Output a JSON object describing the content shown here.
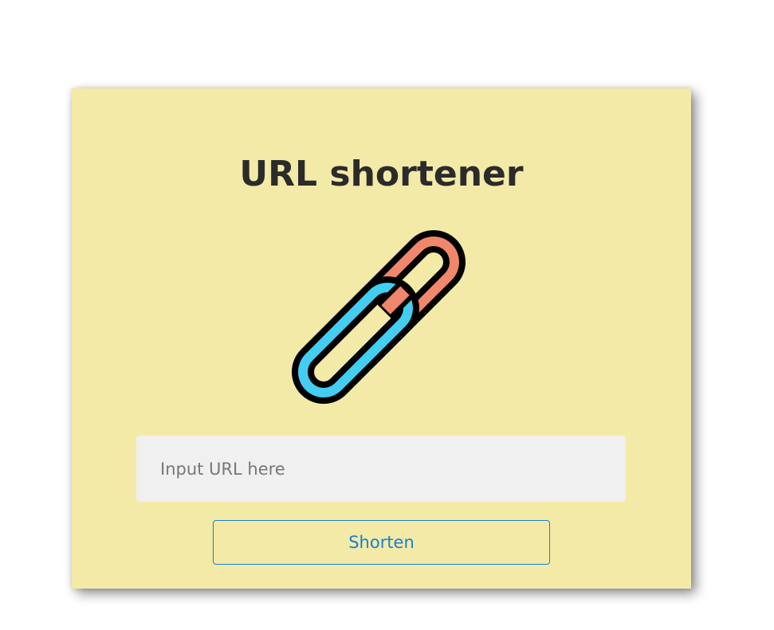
{
  "app": {
    "title": "URL shortener"
  },
  "logo": {
    "icon": "chain-link-icon",
    "colors": {
      "front_link": "#43cdf0",
      "back_link": "#f0866b",
      "outline": "#000000"
    }
  },
  "form": {
    "url_input": {
      "value": "",
      "placeholder": "Input URL here"
    },
    "shorten_label": "Shorten"
  },
  "colors": {
    "card_background": "#f3eaa8",
    "input_background": "#f0f0f0",
    "button_accent": "#1a7fd1"
  }
}
